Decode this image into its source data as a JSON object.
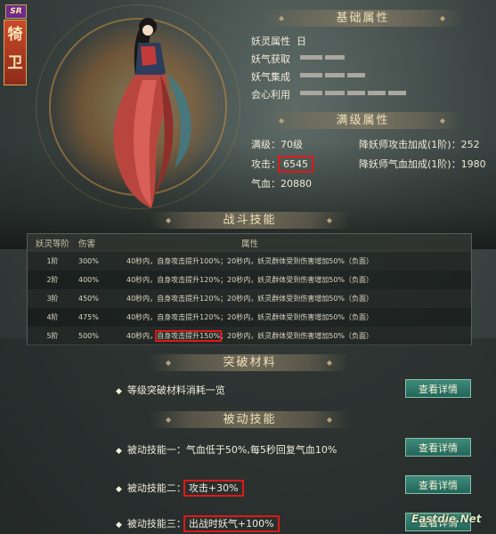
{
  "portrait": {
    "rarity": "SR",
    "name_chars": [
      "犄",
      "卫"
    ]
  },
  "basic": {
    "title": "基础属性",
    "rows": [
      {
        "label": "妖灵属性",
        "value": "日"
      },
      {
        "label": "妖气获取",
        "value": ""
      },
      {
        "label": "妖气集成",
        "value": ""
      },
      {
        "label": "会心利用",
        "value": ""
      }
    ]
  },
  "max_level": {
    "title": "满级属性",
    "level": "满级：70级",
    "attack_label": "攻击：",
    "attack_value": "6545",
    "hp": "气血：20880",
    "bonus_attack": "降妖师攻击加成(1阶)：252",
    "bonus_hp": "降妖师气血加成(1阶)：1980"
  },
  "battle": {
    "title": "战斗技能",
    "headers": [
      "妖灵等阶",
      "伤害",
      "属性"
    ],
    "rows": [
      {
        "lvl": "1阶",
        "dmg": "300%",
        "a": "40秒内，",
        "b": "自身攻击提升100%",
        "c": "；20秒内，妖灵群体受到伤害增加50%（负面）"
      },
      {
        "lvl": "2阶",
        "dmg": "400%",
        "a": "40秒内，",
        "b": "自身攻击提升120%",
        "c": "；20秒内，妖灵群体受到伤害增加50%（负面）"
      },
      {
        "lvl": "3阶",
        "dmg": "450%",
        "a": "40秒内，",
        "b": "自身攻击提升120%",
        "c": "；20秒内，妖灵群体受到伤害增加50%（负面）"
      },
      {
        "lvl": "4阶",
        "dmg": "475%",
        "a": "40秒内，",
        "b": "自身攻击提升120%",
        "c": "；20秒内，妖灵群体受到伤害增加50%（负面）"
      },
      {
        "lvl": "5阶",
        "dmg": "500%",
        "a": "40秒内，",
        "b": "自身攻击提升150%",
        "c": "；20秒内，妖灵群体受到伤害增加50%（负面）"
      }
    ]
  },
  "breakthrough": {
    "title": "突破材料",
    "item": "等级突破材料消耗一览",
    "button": "查看详情"
  },
  "passive": {
    "title": "被动技能",
    "button": "查看详情",
    "s1_label": "被动技能一：",
    "s1_text": "气血低于50%,每5秒回复气血10%",
    "s2_label": "被动技能二：",
    "s2_text": "攻击+30%",
    "s3_label": "被动技能三：",
    "s3_text": "出战时妖气+100%"
  },
  "watermark": "Eastdie.Net",
  "colors": {
    "accent_red": "#e01818",
    "button_teal": "#2a7a6a",
    "rarity_purple": "#6e2a8c"
  }
}
